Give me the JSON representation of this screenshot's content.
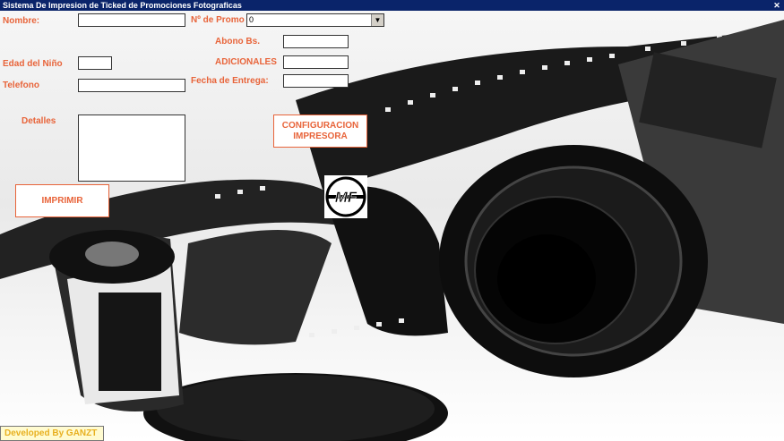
{
  "window": {
    "title": "Sistema De Impresion de Ticked de Promociones Fotograficas",
    "close_glyph": "✕"
  },
  "form": {
    "nombre_label": "Nombre:",
    "nombre_value": "",
    "edad_label": "Edad del Niño",
    "edad_value": "",
    "telefono_label": "Telefono",
    "telefono_value": "",
    "detalles_label": "Detalles",
    "detalles_value": "",
    "promo_label": "Nº de Promo",
    "promo_value": "0",
    "abono_label": "Abono Bs.",
    "abono_value": "",
    "adicionales_label": "ADICIONALES",
    "adicionales_value": "",
    "fecha_label": "Fecha de Entrega:",
    "fecha_value": ""
  },
  "buttons": {
    "config": "CONFIGURACION IMPRESORA",
    "imprimir": "IMPRIMIR"
  },
  "logo": {
    "text": "MF"
  },
  "footer": {
    "text": "Developed By GANZT"
  },
  "icons": {
    "close": "close-icon",
    "dropdown": "chevron-down-icon",
    "logo": "mf-logo-icon"
  }
}
